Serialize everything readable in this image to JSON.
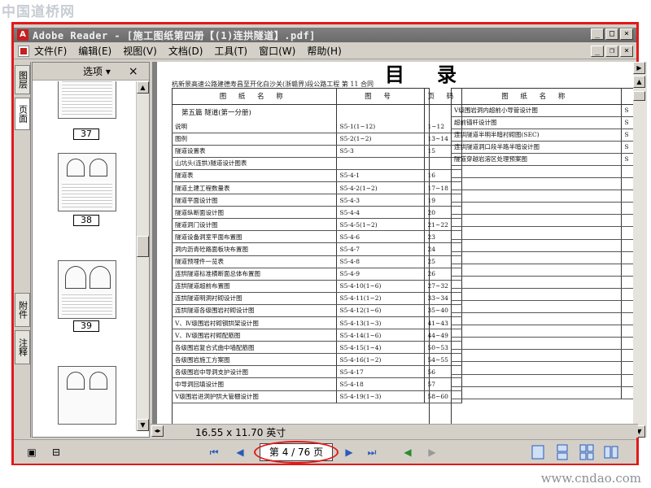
{
  "watermark_top": "中国道桥网",
  "watermark_bottom": "www.cndao.com",
  "window": {
    "app_title": "Adobe Reader - [施工图纸第四册【(1)连拱隧道】.pdf]",
    "app_icon": "adobe-reader-icon"
  },
  "menu": {
    "items": [
      "文件(F)",
      "编辑(E)",
      "视图(V)",
      "文档(D)",
      "工具(T)",
      "窗口(W)",
      "帮助(H)"
    ]
  },
  "nav_tabs": {
    "layers": "图层",
    "pages": "页面",
    "attachments": "附件",
    "comments": "注释"
  },
  "thumbnail_panel": {
    "options_label": "选项 ▾",
    "close": "×",
    "thumbs": [
      {
        "label": "37"
      },
      {
        "label": "38"
      },
      {
        "label": "39"
      }
    ]
  },
  "document": {
    "title": "目录",
    "subtitle": "杭新景高速公路建德寿昌至开化白沙关(浙赣界)段公路工程 第 11 合同",
    "left_table": {
      "headers": [
        "图 纸 名 称",
        "图 号",
        "页 码"
      ],
      "section": "第五篇 隧道(第一分册)",
      "rows": [
        {
          "name": "说明",
          "code": "S5-1(1~12)",
          "page": "1~12"
        },
        {
          "name": "图例",
          "code": "S5-2(1~2)",
          "page": "13~14"
        },
        {
          "name": "隧道设置表",
          "code": "S5-3",
          "page": "15"
        },
        {
          "name": "山坑头(连拱)隧道设计图表",
          "code": "",
          "page": ""
        },
        {
          "name": "隧道表",
          "code": "S5-4-1",
          "page": "16"
        },
        {
          "name": "隧道土建工程数量表",
          "code": "S5-4-2(1~2)",
          "page": "17~18"
        },
        {
          "name": "隧道平面设计图",
          "code": "S5-4-3",
          "page": "19"
        },
        {
          "name": "隧道纵断面设计图",
          "code": "S5-4-4",
          "page": "20"
        },
        {
          "name": "隧道洞门设计图",
          "code": "S5-4-5(1~2)",
          "page": "21~22"
        },
        {
          "name": "隧道设备洞室平面布置图",
          "code": "S5-4-6",
          "page": "23"
        },
        {
          "name": "洞内沥青砼路面板块布置图",
          "code": "S5-4-7",
          "page": "24"
        },
        {
          "name": "隧道预埋件一览表",
          "code": "S5-4-8",
          "page": "25"
        },
        {
          "name": "连拱隧道标准横断面总体布置图",
          "code": "S5-4-9",
          "page": "26"
        },
        {
          "name": "连拱隧道超前布置图",
          "code": "S5-4-10(1~6)",
          "page": "27~32"
        },
        {
          "name": "连拱隧道明洞衬砌设计图",
          "code": "S5-4-11(1~2)",
          "page": "33~34"
        },
        {
          "name": "连拱隧道各级围岩衬砌设计图",
          "code": "S5-4-12(1~6)",
          "page": "35~40"
        },
        {
          "name": "Ⅴ、Ⅳ级围岩衬砌钢拱架设计图",
          "code": "S5-4-13(1~3)",
          "page": "41~43"
        },
        {
          "name": "Ⅴ、Ⅳ级围岩衬砌配筋图",
          "code": "S5-4-14(1~6)",
          "page": "44~49"
        },
        {
          "name": "各级围岩复合式曲中墙配筋图",
          "code": "S5-4-15(1~4)",
          "page": "50~53"
        },
        {
          "name": "各级围岩施工方案图",
          "code": "S5-4-16(1~2)",
          "page": "54~55"
        },
        {
          "name": "各级围岩中导洞支护设计图",
          "code": "S5-4-17",
          "page": "56"
        },
        {
          "name": "中导洞回填设计图",
          "code": "S5-4-18",
          "page": "57"
        },
        {
          "name": "Ⅴ级围岩进洞护拱大管棚设计图",
          "code": "S5-4-19(1~3)",
          "page": "58~60"
        }
      ]
    },
    "right_table": {
      "headers": [
        "图 纸 名 称",
        ""
      ],
      "rows": [
        {
          "name": "Ⅴ级围岩洞内超前小导管设计图",
          "code": "S"
        },
        {
          "name": "超前锚杆设计图",
          "code": "S"
        },
        {
          "name": "连拱隧道半明半暗衬砌图(SEC)",
          "code": "S"
        },
        {
          "name": "连拱隧道洞口段半路半暗设计图",
          "code": "S"
        },
        {
          "name": "隧道穿越岩溶区处理预案图",
          "code": "S"
        },
        {
          "name": "",
          "code": ""
        },
        {
          "name": "",
          "code": ""
        },
        {
          "name": "",
          "code": ""
        },
        {
          "name": "",
          "code": ""
        },
        {
          "name": "",
          "code": ""
        },
        {
          "name": "",
          "code": ""
        },
        {
          "name": "",
          "code": ""
        },
        {
          "name": "",
          "code": ""
        },
        {
          "name": "",
          "code": ""
        },
        {
          "name": "",
          "code": ""
        },
        {
          "name": "",
          "code": ""
        },
        {
          "name": "",
          "code": ""
        },
        {
          "name": "",
          "code": ""
        },
        {
          "name": "",
          "code": ""
        },
        {
          "name": "",
          "code": ""
        },
        {
          "name": "",
          "code": ""
        },
        {
          "name": "",
          "code": ""
        },
        {
          "name": "",
          "code": ""
        },
        {
          "name": "",
          "code": ""
        }
      ]
    }
  },
  "status": {
    "page_size": "16.55 x 11.70 英寸"
  },
  "navigation": {
    "page_indicator": "第 4 / 76 页",
    "current_page": 4,
    "total_pages": 76
  },
  "colors": {
    "highlight_red": "#e11919",
    "nav_blue": "#2a5ab8",
    "nav_green": "#2e8b2e"
  }
}
